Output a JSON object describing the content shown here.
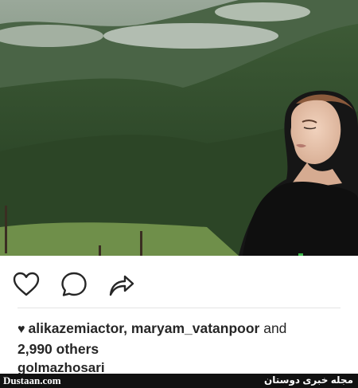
{
  "photo": {
    "description_icon": "photo-image"
  },
  "actions": {
    "like_icon": "heart-outline-icon",
    "comment_icon": "comment-bubble-icon",
    "share_icon": "share-arrow-icon"
  },
  "likes": {
    "users": "alikazemiactor, maryam_vatanpoor",
    "connector": "and",
    "others": "2,990 others"
  },
  "comment": {
    "partial": "golmazhosari"
  },
  "footer": {
    "site": "Dustaan.com",
    "tagline": "مجله خبری دوستان"
  }
}
